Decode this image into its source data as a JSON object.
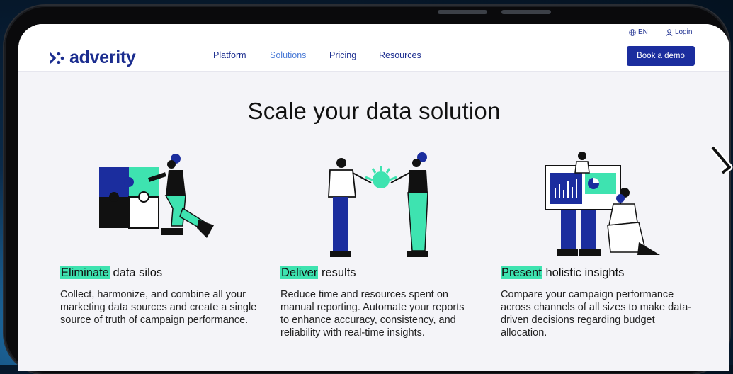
{
  "nav": {
    "logo_text": "adverity",
    "links": [
      "Platform",
      "Solutions",
      "Pricing",
      "Resources"
    ],
    "active_link": "Solutions",
    "language": "EN",
    "login": "Login",
    "cta": "Book a demo"
  },
  "main": {
    "headline": "Scale your data solution",
    "features": [
      {
        "highlight": "Eliminate",
        "title_rest": "data silos",
        "description": "Collect, harmonize, and combine all your marketing data sources and create a single source of truth of campaign performance."
      },
      {
        "highlight": "Deliver",
        "title_rest": "results",
        "description": "Reduce time and resources spent on manual reporting. Automate your reports to enhance accuracy, consistency, and reliability with real-time insights."
      },
      {
        "highlight": "Present",
        "title_rest": "holistic insights",
        "description": "Compare your campaign performance across channels of all sizes to make data-driven decisions regarding budget allocation."
      }
    ]
  },
  "colors": {
    "brand_blue": "#1b2d9e",
    "accent_green": "#3ee3b0",
    "background": "#f4f4f8"
  },
  "icons": [
    "globe-icon",
    "user-icon",
    "adverity-logo-icon"
  ]
}
